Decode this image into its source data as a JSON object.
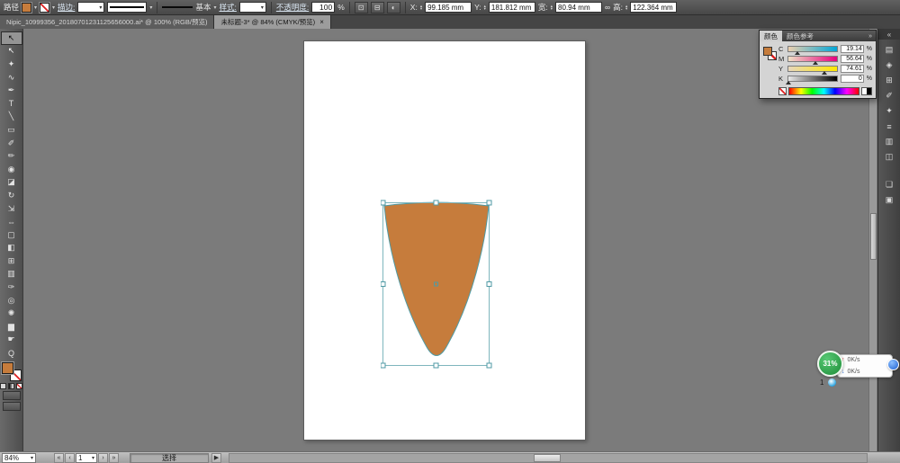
{
  "colors": {
    "fill": "#c67c3c",
    "selection": "#4f9aa4",
    "progress_green": "#2ca845"
  },
  "icons": {
    "dropdown": "▾",
    "spin_up": "▴",
    "spin_down": "▾",
    "menu": "»",
    "collapse": "«",
    "chain": "∞",
    "nav_first": "«",
    "nav_prev": "‹",
    "nav_next": "›",
    "nav_last": "»",
    "arrow_right": "▶",
    "up": "↑",
    "down": "↓"
  },
  "control_bar": {
    "object_label": "路径",
    "stroke_label": "描边:",
    "brush_basic": "基本",
    "style_label": "样式:",
    "opacity_label": "不透明度:",
    "opacity_value": "100",
    "opacity_unit": "%",
    "icon_transform": "⊡",
    "icon_align": "⊟",
    "icon_recolor": "◐",
    "x_label": "X:",
    "x_value": "99.185 mm",
    "y_label": "Y:",
    "y_value": "181.812 mm",
    "w_label": "宽:",
    "w_value": "80.94 mm",
    "h_label": "高:",
    "h_value": "122.364 mm"
  },
  "tab_bar": {
    "tabs": [
      {
        "label": "Nipic_10999356_20180701231125656000.ai* @ 100% (RGB/预览)"
      },
      {
        "label": "未标题-3* @ 84% (CMYK/预览)",
        "close": "×"
      }
    ]
  },
  "tools": [
    {
      "name": "selection-tool",
      "glyph": "↖"
    },
    {
      "name": "direct-selection-tool",
      "glyph": "↖"
    },
    {
      "name": "magic-wand-tool",
      "glyph": "✦"
    },
    {
      "name": "lasso-tool",
      "glyph": "∿"
    },
    {
      "name": "pen-tool",
      "glyph": "✒"
    },
    {
      "name": "type-tool",
      "glyph": "T"
    },
    {
      "name": "line-segment-tool",
      "glyph": "╲"
    },
    {
      "name": "rectangle-tool",
      "glyph": "▭"
    },
    {
      "name": "paintbrush-tool",
      "glyph": "✐"
    },
    {
      "name": "pencil-tool",
      "glyph": "✏"
    },
    {
      "name": "blob-brush-tool",
      "glyph": "◉"
    },
    {
      "name": "eraser-tool",
      "glyph": "◪"
    },
    {
      "name": "rotate-tool",
      "glyph": "↻"
    },
    {
      "name": "scale-tool",
      "glyph": "⇲"
    },
    {
      "name": "width-tool",
      "glyph": "⇔"
    },
    {
      "name": "free-transform-tool",
      "glyph": "▢"
    },
    {
      "name": "shape-builder-tool",
      "glyph": "◧"
    },
    {
      "name": "mesh-tool",
      "glyph": "⊞"
    },
    {
      "name": "gradient-tool",
      "glyph": "▥"
    },
    {
      "name": "eyedropper-tool",
      "glyph": "✑"
    },
    {
      "name": "blend-tool",
      "glyph": "◎"
    },
    {
      "name": "symbol-sprayer-tool",
      "glyph": "✺"
    },
    {
      "name": "column-graph-tool",
      "glyph": "▆"
    },
    {
      "name": "hand-tool",
      "glyph": "☛"
    },
    {
      "name": "zoom-tool",
      "glyph": "Q"
    }
  ],
  "dock": {
    "collapse": "«",
    "icons": [
      {
        "name": "color-panel-icon",
        "glyph": "▤"
      },
      {
        "name": "color-guide-panel-icon",
        "glyph": "◈"
      },
      {
        "name": "swatches-panel-icon",
        "glyph": "⊞"
      },
      {
        "name": "brushes-panel-icon",
        "glyph": "✐"
      },
      {
        "name": "symbols-panel-icon",
        "glyph": "✦"
      },
      {
        "name": "stroke-panel-icon",
        "glyph": "≡"
      },
      {
        "name": "gradient-panel-icon",
        "glyph": "▥"
      },
      {
        "name": "transparency-panel-icon",
        "glyph": "◫"
      },
      {
        "name": "layers-panel-icon",
        "glyph": "❏"
      },
      {
        "name": "artboards-panel-icon",
        "glyph": "▣"
      }
    ]
  },
  "color_panel": {
    "tab_color": "颜色",
    "tab_guide": "颜色参考",
    "rows": [
      {
        "channel": "C",
        "value": "19.14",
        "unit": "%"
      },
      {
        "channel": "M",
        "value": "56.64",
        "unit": "%"
      },
      {
        "channel": "Y",
        "value": "74.61",
        "unit": "%"
      },
      {
        "channel": "K",
        "value": "0",
        "unit": "%"
      }
    ]
  },
  "status_bar": {
    "zoom": "84%",
    "page_value": "1",
    "tool_name": "选择"
  },
  "overlay_widget": {
    "progress": "31%",
    "rows": [
      {
        "speed": "0K/s"
      },
      {
        "speed": "0K/s"
      }
    ],
    "count": "1"
  }
}
